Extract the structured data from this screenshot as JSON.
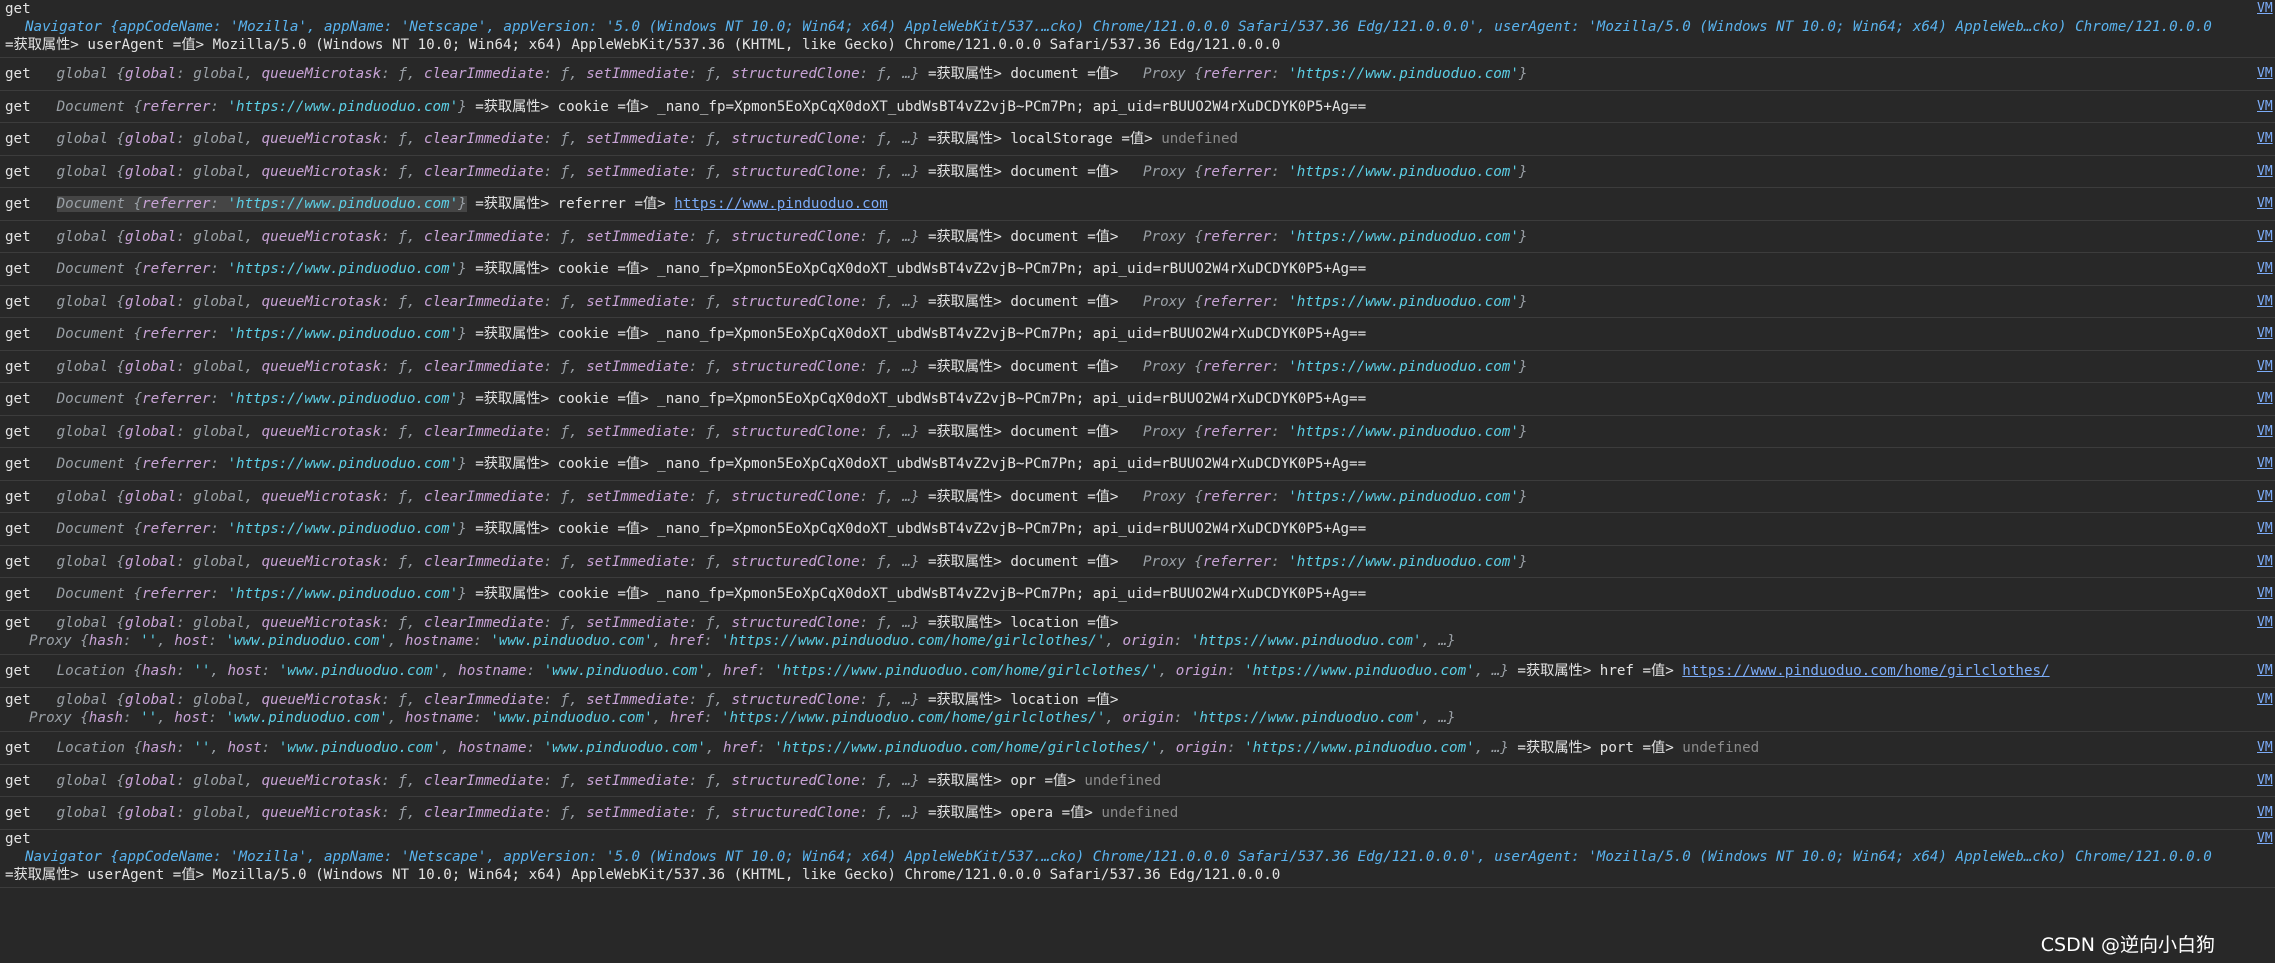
{
  "source_link": "VM",
  "watermark": "CSDN @逆向小白狗",
  "rows": [
    {
      "id": "r0",
      "kind": "navigator-top",
      "get": "get",
      "preview": "Navigator {appCodeName: 'Mozilla', appName: 'Netscape', appVersion: '5.0 (Windows NT 10.0; Win64; x64) AppleWebKit/537.…cko) Chrome/121.0.0.0 Safari/537.36 Edg/121.0.0.0', userAgent: 'Mozilla/5.0 (Windows NT 10.0; Win64; x64) AppleWeb…cko) Chrome/121.0.0.0 Safari/537.36 Edg/121.0.0.0'}",
      "tail": "=获取属性> userAgent =值> Mozilla/5.0 (Windows NT 10.0; Win64; x64) AppleWebKit/537.36 (KHTML, like Gecko) Chrome/121.0.0.0 Safari/537.36 Edg/121.0.0.0"
    },
    {
      "id": "r1",
      "get": "get",
      "obj": "global {global: global, queueMicrotask: ƒ, clearImmediate: ƒ, setImmediate: ƒ, structuredClone: ƒ, …}",
      "mid": " =获取属性> document =值> ",
      "val": "Proxy {referrer: 'https://www.pinduoduo.com'}",
      "valtype": "obj"
    },
    {
      "id": "r2",
      "get": "get",
      "obj": "Document {referrer: 'https://www.pinduoduo.com'}",
      "mid": " =获取属性> cookie =值> _nano_fp=Xpmon5EoXpCqX0doXT_ubdWsBT4vZ2vjB~PCm7Pn; api_uid=rBUUO2W4rXuDCDYK0P5+Ag==",
      "val": "",
      "valtype": "none"
    },
    {
      "id": "r3",
      "get": "get",
      "obj": "global {global: global, queueMicrotask: ƒ, clearImmediate: ƒ, setImmediate: ƒ, structuredClone: ƒ, …}",
      "mid": " =获取属性> localStorage =值> ",
      "val": "undefined",
      "valtype": "undef"
    },
    {
      "id": "r4",
      "get": "get",
      "obj": "global {global: global, queueMicrotask: ƒ, clearImmediate: ƒ, setImmediate: ƒ, structuredClone: ƒ, …}",
      "mid": " =获取属性> document =值> ",
      "val": "Proxy {referrer: 'https://www.pinduoduo.com'}",
      "valtype": "obj"
    },
    {
      "id": "r5",
      "get": "get",
      "obj": "Document {referrer: 'https://www.pinduoduo.com'}",
      "mid": " =获取属性> referrer =值> ",
      "val": "https://www.pinduoduo.com",
      "valtype": "link",
      "highlight": true
    },
    {
      "id": "r6",
      "get": "get",
      "obj": "global {global: global, queueMicrotask: ƒ, clearImmediate: ƒ, setImmediate: ƒ, structuredClone: ƒ, …}",
      "mid": " =获取属性> document =值> ",
      "val": "Proxy {referrer: 'https://www.pinduoduo.com'}",
      "valtype": "obj"
    },
    {
      "id": "r7",
      "get": "get",
      "obj": "Document {referrer: 'https://www.pinduoduo.com'}",
      "mid": " =获取属性> cookie =值> _nano_fp=Xpmon5EoXpCqX0doXT_ubdWsBT4vZ2vjB~PCm7Pn; api_uid=rBUUO2W4rXuDCDYK0P5+Ag==",
      "val": "",
      "valtype": "none"
    },
    {
      "id": "r8",
      "get": "get",
      "obj": "global {global: global, queueMicrotask: ƒ, clearImmediate: ƒ, setImmediate: ƒ, structuredClone: ƒ, …}",
      "mid": " =获取属性> document =值> ",
      "val": "Proxy {referrer: 'https://www.pinduoduo.com'}",
      "valtype": "obj"
    },
    {
      "id": "r9",
      "get": "get",
      "obj": "Document {referrer: 'https://www.pinduoduo.com'}",
      "mid": " =获取属性> cookie =值> _nano_fp=Xpmon5EoXpCqX0doXT_ubdWsBT4vZ2vjB~PCm7Pn; api_uid=rBUUO2W4rXuDCDYK0P5+Ag==",
      "val": "",
      "valtype": "none"
    },
    {
      "id": "r10",
      "get": "get",
      "obj": "global {global: global, queueMicrotask: ƒ, clearImmediate: ƒ, setImmediate: ƒ, structuredClone: ƒ, …}",
      "mid": " =获取属性> document =值> ",
      "val": "Proxy {referrer: 'https://www.pinduoduo.com'}",
      "valtype": "obj"
    },
    {
      "id": "r11",
      "get": "get",
      "obj": "Document {referrer: 'https://www.pinduoduo.com'}",
      "mid": " =获取属性> cookie =值> _nano_fp=Xpmon5EoXpCqX0doXT_ubdWsBT4vZ2vjB~PCm7Pn; api_uid=rBUUO2W4rXuDCDYK0P5+Ag==",
      "val": "",
      "valtype": "none"
    },
    {
      "id": "r12",
      "get": "get",
      "obj": "global {global: global, queueMicrotask: ƒ, clearImmediate: ƒ, setImmediate: ƒ, structuredClone: ƒ, …}",
      "mid": " =获取属性> document =值> ",
      "val": "Proxy {referrer: 'https://www.pinduoduo.com'}",
      "valtype": "obj"
    },
    {
      "id": "r13",
      "get": "get",
      "obj": "Document {referrer: 'https://www.pinduoduo.com'}",
      "mid": " =获取属性> cookie =值> _nano_fp=Xpmon5EoXpCqX0doXT_ubdWsBT4vZ2vjB~PCm7Pn; api_uid=rBUUO2W4rXuDCDYK0P5+Ag==",
      "val": "",
      "valtype": "none"
    },
    {
      "id": "r14",
      "get": "get",
      "obj": "global {global: global, queueMicrotask: ƒ, clearImmediate: ƒ, setImmediate: ƒ, structuredClone: ƒ, …}",
      "mid": " =获取属性> document =值> ",
      "val": "Proxy {referrer: 'https://www.pinduoduo.com'}",
      "valtype": "obj"
    },
    {
      "id": "r15",
      "get": "get",
      "obj": "Document {referrer: 'https://www.pinduoduo.com'}",
      "mid": " =获取属性> cookie =值> _nano_fp=Xpmon5EoXpCqX0doXT_ubdWsBT4vZ2vjB~PCm7Pn; api_uid=rBUUO2W4rXuDCDYK0P5+Ag==",
      "val": "",
      "valtype": "none"
    },
    {
      "id": "r16",
      "get": "get",
      "obj": "global {global: global, queueMicrotask: ƒ, clearImmediate: ƒ, setImmediate: ƒ, structuredClone: ƒ, …}",
      "mid": " =获取属性> document =值> ",
      "val": "Proxy {referrer: 'https://www.pinduoduo.com'}",
      "valtype": "obj"
    },
    {
      "id": "r17",
      "get": "get",
      "obj": "Document {referrer: 'https://www.pinduoduo.com'}",
      "mid": " =获取属性> cookie =值> _nano_fp=Xpmon5EoXpCqX0doXT_ubdWsBT4vZ2vjB~PCm7Pn; api_uid=rBUUO2W4rXuDCDYK0P5+Ag==",
      "val": "",
      "valtype": "none"
    },
    {
      "id": "r18",
      "kind": "double",
      "get": "get",
      "obj": "global {global: global, queueMicrotask: ƒ, clearImmediate: ƒ, setImmediate: ƒ, structuredClone: ƒ, …}",
      "mid": " =获取属性> location =值>",
      "line2": "Proxy {hash: '', host: 'www.pinduoduo.com', hostname: 'www.pinduoduo.com', href: 'https://www.pinduoduo.com/home/girlclothes/', origin: 'https://www.pinduoduo.com', …}"
    },
    {
      "id": "r19",
      "get": "get",
      "obj": "Location {hash: '', host: 'www.pinduoduo.com', hostname: 'www.pinduoduo.com', href: 'https://www.pinduoduo.com/home/girlclothes/', origin: 'https://www.pinduoduo.com', …}",
      "mid": " =获取属性> href =值> ",
      "val": "https://www.pinduoduo.com/home/girlclothes/",
      "valtype": "link"
    },
    {
      "id": "r20",
      "kind": "double",
      "get": "get",
      "obj": "global {global: global, queueMicrotask: ƒ, clearImmediate: ƒ, setImmediate: ƒ, structuredClone: ƒ, …}",
      "mid": " =获取属性> location =值>",
      "line2": "Proxy {hash: '', host: 'www.pinduoduo.com', hostname: 'www.pinduoduo.com', href: 'https://www.pinduoduo.com/home/girlclothes/', origin: 'https://www.pinduoduo.com', …}"
    },
    {
      "id": "r21",
      "get": "get",
      "obj": "Location {hash: '', host: 'www.pinduoduo.com', hostname: 'www.pinduoduo.com', href: 'https://www.pinduoduo.com/home/girlclothes/', origin: 'https://www.pinduoduo.com', …}",
      "mid": " =获取属性> port =值> ",
      "val": "undefined",
      "valtype": "undef"
    },
    {
      "id": "r22",
      "get": "get",
      "obj": "global {global: global, queueMicrotask: ƒ, clearImmediate: ƒ, setImmediate: ƒ, structuredClone: ƒ, …}",
      "mid": " =获取属性> opr =值> ",
      "val": "undefined",
      "valtype": "undef"
    },
    {
      "id": "r23",
      "get": "get",
      "obj": "global {global: global, queueMicrotask: ƒ, clearImmediate: ƒ, setImmediate: ƒ, structuredClone: ƒ, …}",
      "mid": " =获取属性> opera =值> ",
      "val": "undefined",
      "valtype": "undef"
    },
    {
      "id": "r24",
      "kind": "navigator-bottom",
      "get": "get",
      "preview": "Navigator {appCodeName: 'Mozilla', appName: 'Netscape', appVersion: '5.0 (Windows NT 10.0; Win64; x64) AppleWebKit/537.…cko) Chrome/121.0.0.0 Safari/537.36 Edg/121.0.0.0', userAgent: 'Mozilla/5.0 (Windows NT 10.0; Win64; x64) AppleWeb…cko) Chrome/121.0.0.0 Safari/537.36 Edg/121.0.0.0'}",
      "tail": "=获取属性> userAgent =值> Mozilla/5.0 (Windows NT 10.0; Win64; x64) AppleWebKit/537.36 (KHTML, like Gecko) Chrome/121.0.0.0 Safari/537.36 Edg/121.0.0.0"
    }
  ]
}
